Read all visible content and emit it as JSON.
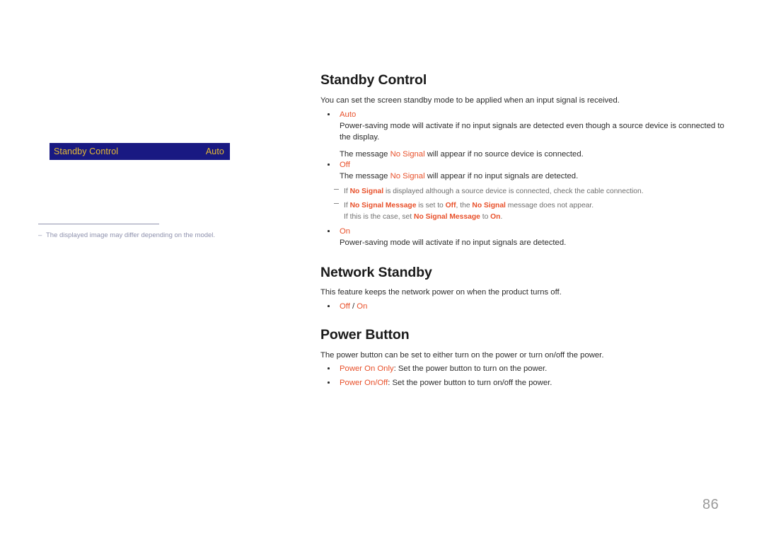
{
  "page": {
    "number": "86",
    "background": "#ffffff",
    "accent_color": "#e8502a",
    "osd_bar_color": "#191982",
    "osd_text_color": "#e8bb33",
    "note_color": "#8e91ad"
  },
  "osd": {
    "label": "Standby Control",
    "value": "Auto"
  },
  "left_note": {
    "dash": "–",
    "text": "The displayed image may differ depending on the model."
  },
  "sections": [
    {
      "heading": "Standby Control",
      "intro": "You can set the screen standby mode to be applied when an input signal is received.",
      "items": [
        {
          "option": "Auto",
          "lines": [
            {
              "parts": [
                {
                  "t": "Power-saving mode will activate if no input signals are detected even though a source device is connected to the display.",
                  "style": "plain"
                }
              ]
            },
            {
              "parts": [
                {
                  "t": "The message ",
                  "style": "plain"
                },
                {
                  "t": "No Signal",
                  "style": "term"
                },
                {
                  "t": " will appear if no source device is connected.",
                  "style": "plain"
                }
              ]
            }
          ]
        },
        {
          "option": "Off",
          "lines": [
            {
              "parts": [
                {
                  "t": "The message ",
                  "style": "plain"
                },
                {
                  "t": "No Signal",
                  "style": "term"
                },
                {
                  "t": " will appear if no input signals are detected.",
                  "style": "plain"
                }
              ]
            }
          ]
        }
      ],
      "subnotes": [
        {
          "parts": [
            {
              "t": "If ",
              "style": "note"
            },
            {
              "t": "No Signal",
              "style": "note-bold"
            },
            {
              "t": " is displayed although a source device is connected, check the cable connection.",
              "style": "note"
            }
          ]
        },
        {
          "parts": [
            {
              "t": "If ",
              "style": "note"
            },
            {
              "t": "No Signal Message",
              "style": "note-bold"
            },
            {
              "t": " is set to ",
              "style": "note"
            },
            {
              "t": "Off",
              "style": "note-bold"
            },
            {
              "t": ", the ",
              "style": "note"
            },
            {
              "t": "No Signal",
              "style": "note-bold"
            },
            {
              "t": " message does not appear.",
              "style": "note"
            }
          ],
          "second_line": {
            "parts": [
              {
                "t": "If this is the case, set ",
                "style": "note"
              },
              {
                "t": "No Signal Message",
                "style": "note-bold"
              },
              {
                "t": " to ",
                "style": "note"
              },
              {
                "t": "On",
                "style": "note-bold"
              },
              {
                "t": ".",
                "style": "note"
              }
            ]
          }
        }
      ],
      "trailing_items": [
        {
          "option": "On",
          "lines": [
            {
              "parts": [
                {
                  "t": "Power-saving mode will activate if no input signals are detected.",
                  "style": "plain"
                }
              ]
            }
          ]
        }
      ]
    },
    {
      "heading": "Network Standby",
      "intro": "This feature keeps the network power on when the product turns off.",
      "inline_options": [
        {
          "t": "Off",
          "style": "term"
        },
        {
          "t": " / ",
          "style": "plain"
        },
        {
          "t": "On",
          "style": "term"
        }
      ]
    },
    {
      "heading": "Power Button",
      "intro": "The power button can be set to either turn on the power or turn on/off the power.",
      "labeled_items": [
        {
          "parts": [
            {
              "t": "Power On Only",
              "style": "term"
            },
            {
              "t": ": Set the power button to turn on the power.",
              "style": "plain"
            }
          ]
        },
        {
          "parts": [
            {
              "t": "Power On/Off",
              "style": "term"
            },
            {
              "t": ": Set the power button to turn on/off the power.",
              "style": "plain"
            }
          ]
        }
      ]
    }
  ]
}
